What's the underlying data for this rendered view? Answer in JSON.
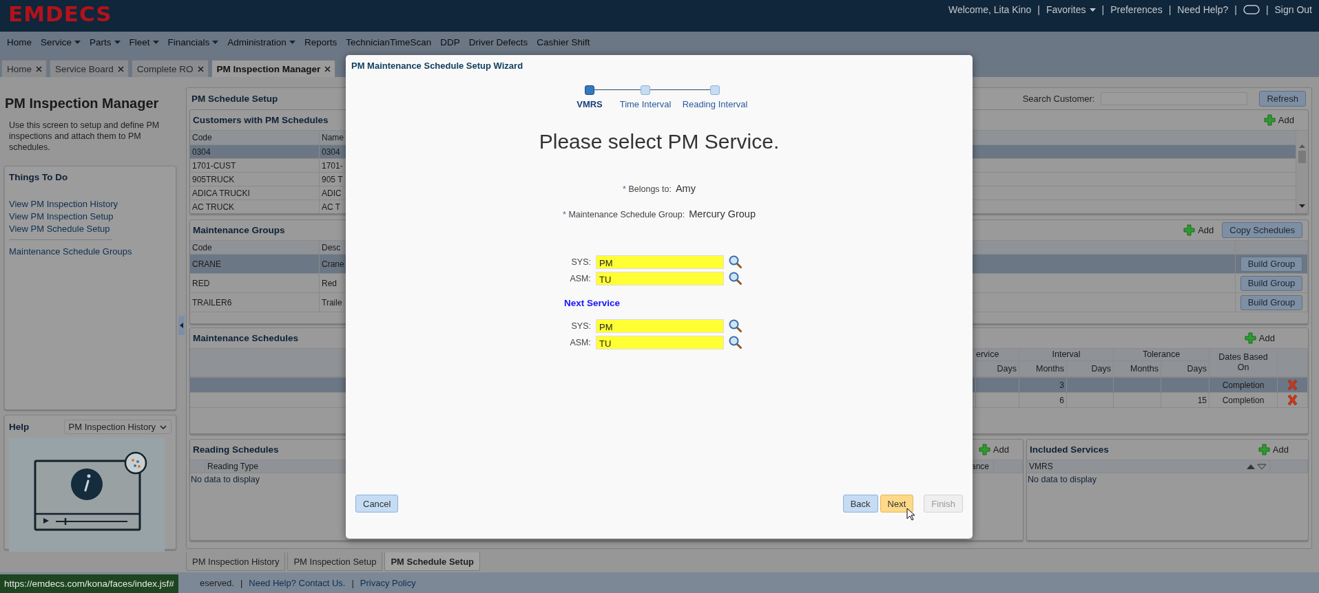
{
  "header": {
    "logo": "EMDECS",
    "items": [
      {
        "kind": "text",
        "label": "Welcome, Lita Kino"
      },
      {
        "kind": "separator",
        "label": "|"
      },
      {
        "kind": "dropdown",
        "label": "Favorites"
      },
      {
        "kind": "separator",
        "label": "|"
      },
      {
        "kind": "link",
        "label": "Preferences"
      },
      {
        "kind": "separator",
        "label": "|"
      },
      {
        "kind": "link",
        "label": "Need Help?"
      },
      {
        "kind": "separator",
        "label": "|"
      },
      {
        "kind": "toggle"
      },
      {
        "kind": "separator",
        "label": "|"
      },
      {
        "kind": "link",
        "label": "Sign Out"
      }
    ]
  },
  "menu": [
    {
      "label": "Home",
      "dropdown": false
    },
    {
      "label": "Service",
      "dropdown": true
    },
    {
      "label": "Parts",
      "dropdown": true
    },
    {
      "label": "Fleet",
      "dropdown": true
    },
    {
      "label": "Financials",
      "dropdown": true
    },
    {
      "label": "Administration",
      "dropdown": true
    },
    {
      "label": "Reports",
      "dropdown": false
    },
    {
      "label": "TechnicianTimeScan",
      "dropdown": false
    },
    {
      "label": "DDP",
      "dropdown": false
    },
    {
      "label": "Driver Defects",
      "dropdown": false
    },
    {
      "label": "Cashier Shift",
      "dropdown": false
    }
  ],
  "tabs": [
    {
      "label": "Home",
      "selected": false
    },
    {
      "label": "Service Board",
      "selected": false
    },
    {
      "label": "Complete RO",
      "selected": false
    },
    {
      "label": "PM Inspection Manager",
      "selected": true
    }
  ],
  "left": {
    "title": "PM Inspection Manager",
    "description": "Use this screen to setup and define PM inspections and attach them to PM schedules.",
    "things_to_do": {
      "title": "Things To Do",
      "links": [
        "View PM Inspection History",
        "View PM Inspection Setup",
        "View PM Schedule Setup"
      ],
      "more_links": [
        "Maintenance Schedule Groups"
      ]
    },
    "help": {
      "title": "Help",
      "select": "PM Inspection History"
    }
  },
  "main": {
    "title": "PM Schedule Setup",
    "search_label": "Search Customer:",
    "refresh": "Refresh",
    "customers": {
      "title": "Customers with PM Schedules",
      "add": "Add",
      "columns": [
        "Code",
        "Name"
      ],
      "rows": [
        {
          "cells": [
            "0304",
            "0304"
          ],
          "selected": true
        },
        {
          "cells": [
            "1701-CUST",
            "1701-"
          ],
          "selected": false
        },
        {
          "cells": [
            "905TRUCK",
            "905 T"
          ],
          "selected": false
        },
        {
          "cells": [
            "ADICA TRUCKI",
            "ADIC"
          ],
          "selected": false
        },
        {
          "cells": [
            "AC TRUCK",
            "AC T"
          ],
          "selected": false
        }
      ]
    },
    "groups": {
      "title": "Maintenance Groups",
      "add": "Add",
      "copy": "Copy Schedules",
      "columns": [
        "Code",
        "Desc"
      ],
      "rows": [
        {
          "cells": [
            "CRANE",
            "Crane"
          ],
          "action": "Build Group",
          "selected": true
        },
        {
          "cells": [
            "RED",
            "Red"
          ],
          "action": "Build Group",
          "selected": false
        },
        {
          "cells": [
            "TRAILER6",
            "Traile"
          ],
          "action": "Build Group",
          "selected": false
        }
      ]
    },
    "schedules": {
      "title": "Maintenance Schedules",
      "add": "Add",
      "service_header": "ervice",
      "interval_header": "Interval",
      "tolerance_header": "Tolerance",
      "dates_header": "Dates Based On",
      "sub_headers": [
        "Days",
        "Months",
        "Days",
        "Months",
        "Days"
      ],
      "rows": [
        {
          "interval_months": "3",
          "dates_based_on": "Completion",
          "selected": true
        },
        {
          "interval_months": "6",
          "tolerance_days": "15",
          "dates_based_on": "Completion",
          "selected": false
        }
      ]
    },
    "reading": {
      "title": "Reading Schedules",
      "add": "Add",
      "columns": [
        "Reading Type",
        "ance"
      ],
      "empty": "No data to display"
    },
    "included": {
      "title": "Included Services",
      "add": "Add",
      "columns": [
        "VMRS"
      ],
      "empty": "No data to display"
    }
  },
  "bottom_tabs": [
    {
      "label": "PM Inspection History",
      "selected": false
    },
    {
      "label": "PM Inspection Setup",
      "selected": false
    },
    {
      "label": "PM Schedule Setup",
      "selected": true
    }
  ],
  "footer": {
    "status_url": "https://emdecs.com/kona/faces/index.jsf#",
    "items": [
      {
        "kind": "text",
        "label": "eserved."
      },
      {
        "kind": "separator",
        "label": "|"
      },
      {
        "kind": "link",
        "label": "Need Help? Contact Us."
      },
      {
        "kind": "separator",
        "label": "|"
      },
      {
        "kind": "link",
        "label": "Privacy Policy"
      }
    ]
  },
  "dialog": {
    "title": "PM Maintenance Schedule Setup Wizard",
    "steps": [
      {
        "label": "VMRS",
        "selected": true
      },
      {
        "label": "Time Interval",
        "selected": false
      },
      {
        "label": "Reading Interval",
        "selected": false
      }
    ],
    "heading": "Please select PM Service.",
    "info": [
      {
        "marker": "*",
        "label": "Belongs to:",
        "value": "Amy"
      },
      {
        "marker": "*",
        "label": "Maintenance Schedule Group:",
        "value": "Mercury Group"
      }
    ],
    "service": [
      {
        "label": "SYS:",
        "value": "PM"
      },
      {
        "label": "ASM:",
        "value": "TU"
      }
    ],
    "next_service_title": "Next Service",
    "next_service": [
      {
        "label": "SYS:",
        "value": "PM"
      },
      {
        "label": "ASM:",
        "value": "TU"
      }
    ],
    "cancel": "Cancel",
    "buttons": [
      {
        "label": "Back",
        "highlighted": false,
        "disabled": false
      },
      {
        "label": "Next",
        "highlighted": true,
        "disabled": false
      },
      {
        "label": "Finish",
        "highlighted": false,
        "disabled": true
      }
    ]
  }
}
